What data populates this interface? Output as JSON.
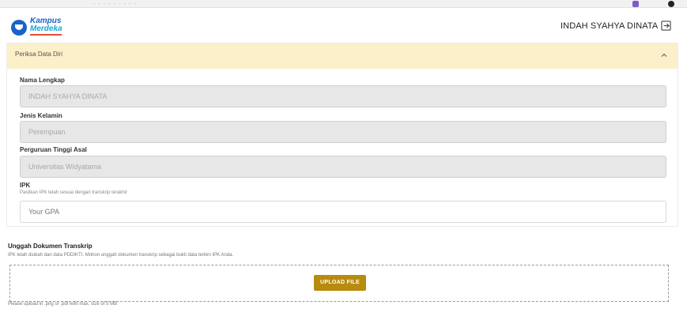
{
  "browser": {
    "dots": "· · ·  ·  · ·  · · ·"
  },
  "header": {
    "logo_line1": "Kampus",
    "logo_line2": "Merdeka",
    "username": "INDAH SYAHYA DINATA"
  },
  "panel": {
    "title": "Periksa Data Diri",
    "fields": [
      {
        "label": "Nama Lengkap",
        "value": "INDAH SYAHYA DINATA"
      },
      {
        "label": "Jenis Kelamin",
        "value": "Perempuan"
      },
      {
        "label": "Perguruan Tinggi Asal",
        "value": "Universitas Widyatama"
      }
    ],
    "ipk": {
      "label": "IPK",
      "help": "Pastikan IPK telah sesuai dengan transkrip terakhir",
      "placeholder": "Your GPA"
    }
  },
  "upload": {
    "title": "Unggah Dokumen Transkrip",
    "description": "IPK telah diubah dari data PDDIKTI. Mohon unggah dokumen transkrip sebagai bukti data terkini IPK Anda.",
    "button_label": "UPLOAD FILE",
    "hint": "Please upload in .png or .pdf with max. size of 5 MB"
  },
  "colors": {
    "panel_header_bg": "#fbf0c9",
    "upload_button": "#b88b0e",
    "brand_blue": "#1a63c6"
  },
  "icons": [
    "kampus-merdeka-logo",
    "logout-icon",
    "chevron-up-icon"
  ]
}
